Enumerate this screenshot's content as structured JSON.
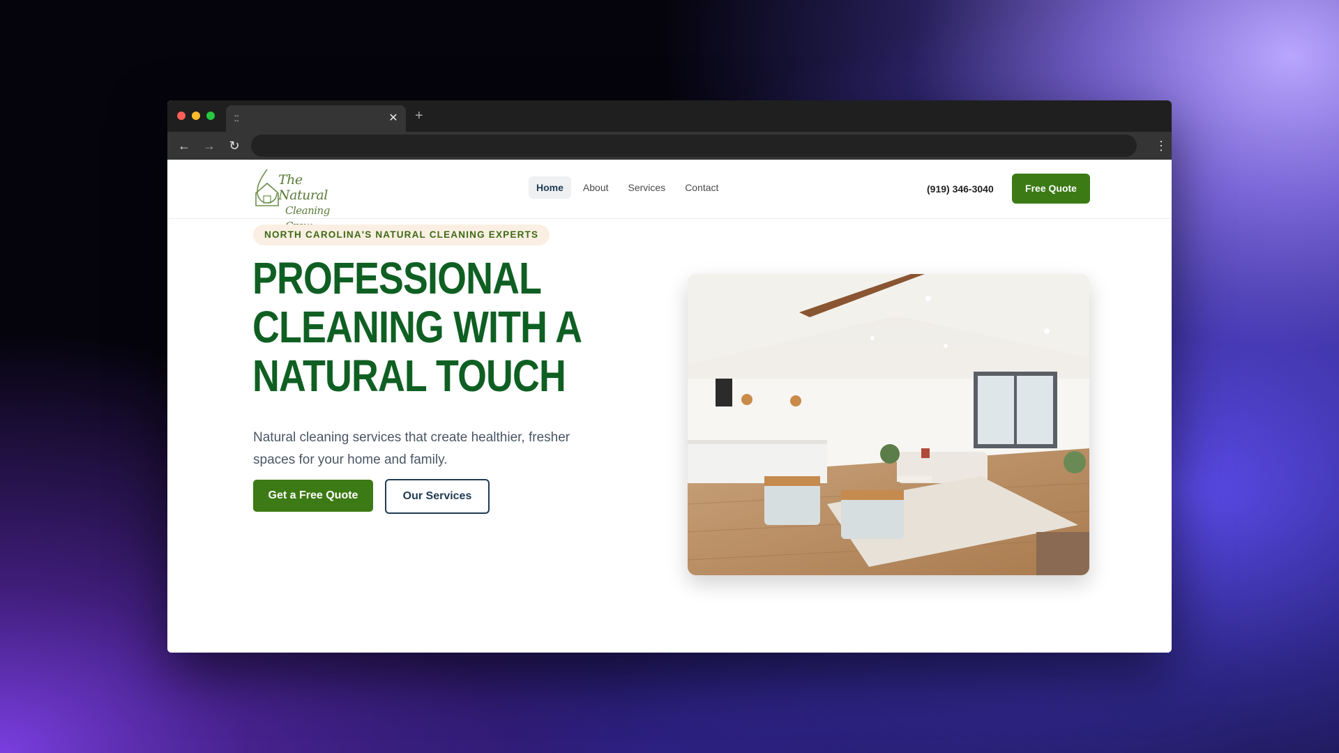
{
  "browser": {
    "tab_close": "✕",
    "new_tab": "+",
    "back": "←",
    "forward": "→",
    "reload": "↻",
    "menu": "⋮",
    "address": ""
  },
  "site": {
    "logo": {
      "line1": "The Natural",
      "line2": "Cleaning Crew"
    },
    "nav": [
      {
        "label": "Home",
        "active": true
      },
      {
        "label": "About",
        "active": false
      },
      {
        "label": "Services",
        "active": false
      },
      {
        "label": "Contact",
        "active": false
      }
    ],
    "phone": "(919) 346-3040",
    "header_cta": "Free Quote"
  },
  "hero": {
    "eyebrow": "NORTH CAROLINA'S NATURAL CLEANING EXPERTS",
    "headline": [
      "PROFESSIONAL",
      "CLEANING WITH A",
      "NATURAL TOUCH"
    ],
    "subtext": "Natural cleaning services that create healthier, fresher spaces for your home and family.",
    "primary_cta": "Get a Free Quote",
    "secondary_cta": "Our Services"
  },
  "colors": {
    "brand_green": "#3c7a15",
    "headline_green": "#0f5f23",
    "navy": "#1f3b53",
    "eyebrow_bg": "#fbefe4"
  }
}
